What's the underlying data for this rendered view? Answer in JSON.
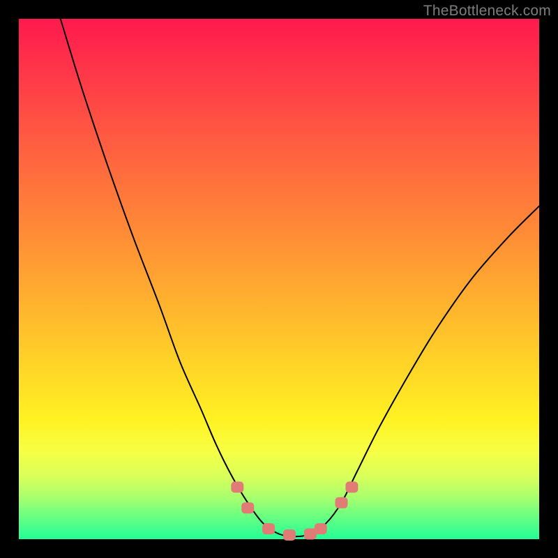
{
  "watermark": "TheBottleneck.com",
  "chart_data": {
    "type": "line",
    "title": "",
    "xlabel": "",
    "ylabel": "",
    "xlim": [
      0,
      100
    ],
    "ylim": [
      0,
      100
    ],
    "grid": false,
    "series": [
      {
        "name": "curve",
        "x": [
          8,
          12,
          17,
          22,
          27,
          31,
          35,
          38,
          41,
          44,
          47,
          50,
          53,
          56,
          59,
          62,
          65,
          69,
          74,
          80,
          87,
          94,
          100
        ],
        "y": [
          100,
          87,
          72,
          58,
          45,
          34,
          25,
          18,
          12,
          7,
          3,
          1,
          0.5,
          1,
          3,
          7,
          13,
          21,
          30,
          40,
          50,
          58,
          64
        ]
      }
    ],
    "markers": {
      "name": "bottom-callouts",
      "points": [
        {
          "x": 42,
          "y": 10
        },
        {
          "x": 44,
          "y": 6
        },
        {
          "x": 48,
          "y": 2
        },
        {
          "x": 52,
          "y": 0.8
        },
        {
          "x": 56,
          "y": 1
        },
        {
          "x": 58,
          "y": 2
        },
        {
          "x": 62,
          "y": 7
        },
        {
          "x": 64,
          "y": 10
        }
      ],
      "shape": "rounded-rect",
      "color": "#e07b76"
    },
    "background_gradient": {
      "direction": "vertical",
      "stops": [
        {
          "pos": 0.0,
          "color": "#ff1a4f"
        },
        {
          "pos": 0.3,
          "color": "#ff6b3e"
        },
        {
          "pos": 0.6,
          "color": "#ffd028"
        },
        {
          "pos": 0.8,
          "color": "#fff122"
        },
        {
          "pos": 1.0,
          "color": "#24ff97"
        }
      ]
    }
  }
}
